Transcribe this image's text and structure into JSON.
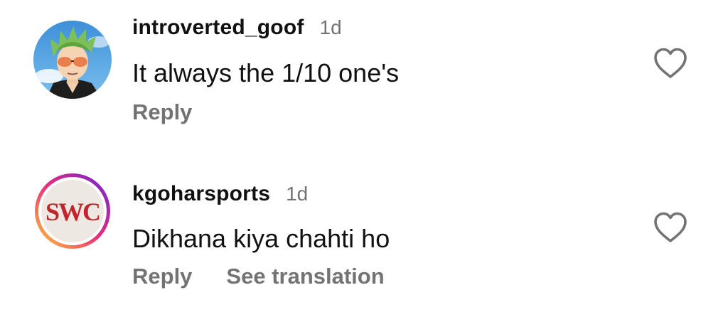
{
  "colors": {
    "username": "#111111",
    "text": "#111111",
    "secondary": "#737373",
    "story_ring_start": "#f9ce34",
    "story_ring_mid": "#ee2a7b",
    "story_ring_end": "#6228d7",
    "swc_logo": "#c0262d"
  },
  "comments": [
    {
      "username": "introverted_goof",
      "timestamp": "1d",
      "text": "It always the 1/10 one's",
      "avatar_icon": "anime-character-avatar",
      "actions": {
        "reply": "Reply"
      },
      "like_icon": "heart-outline-icon"
    },
    {
      "username": "kgoharsports",
      "timestamp": "1d",
      "text": "Dikhana kiya chahti ho",
      "avatar_icon": "swc-logo-avatar",
      "avatar_logo_text": "SWC",
      "actions": {
        "reply": "Reply",
        "see_translation": "See translation"
      },
      "like_icon": "heart-outline-icon"
    }
  ]
}
